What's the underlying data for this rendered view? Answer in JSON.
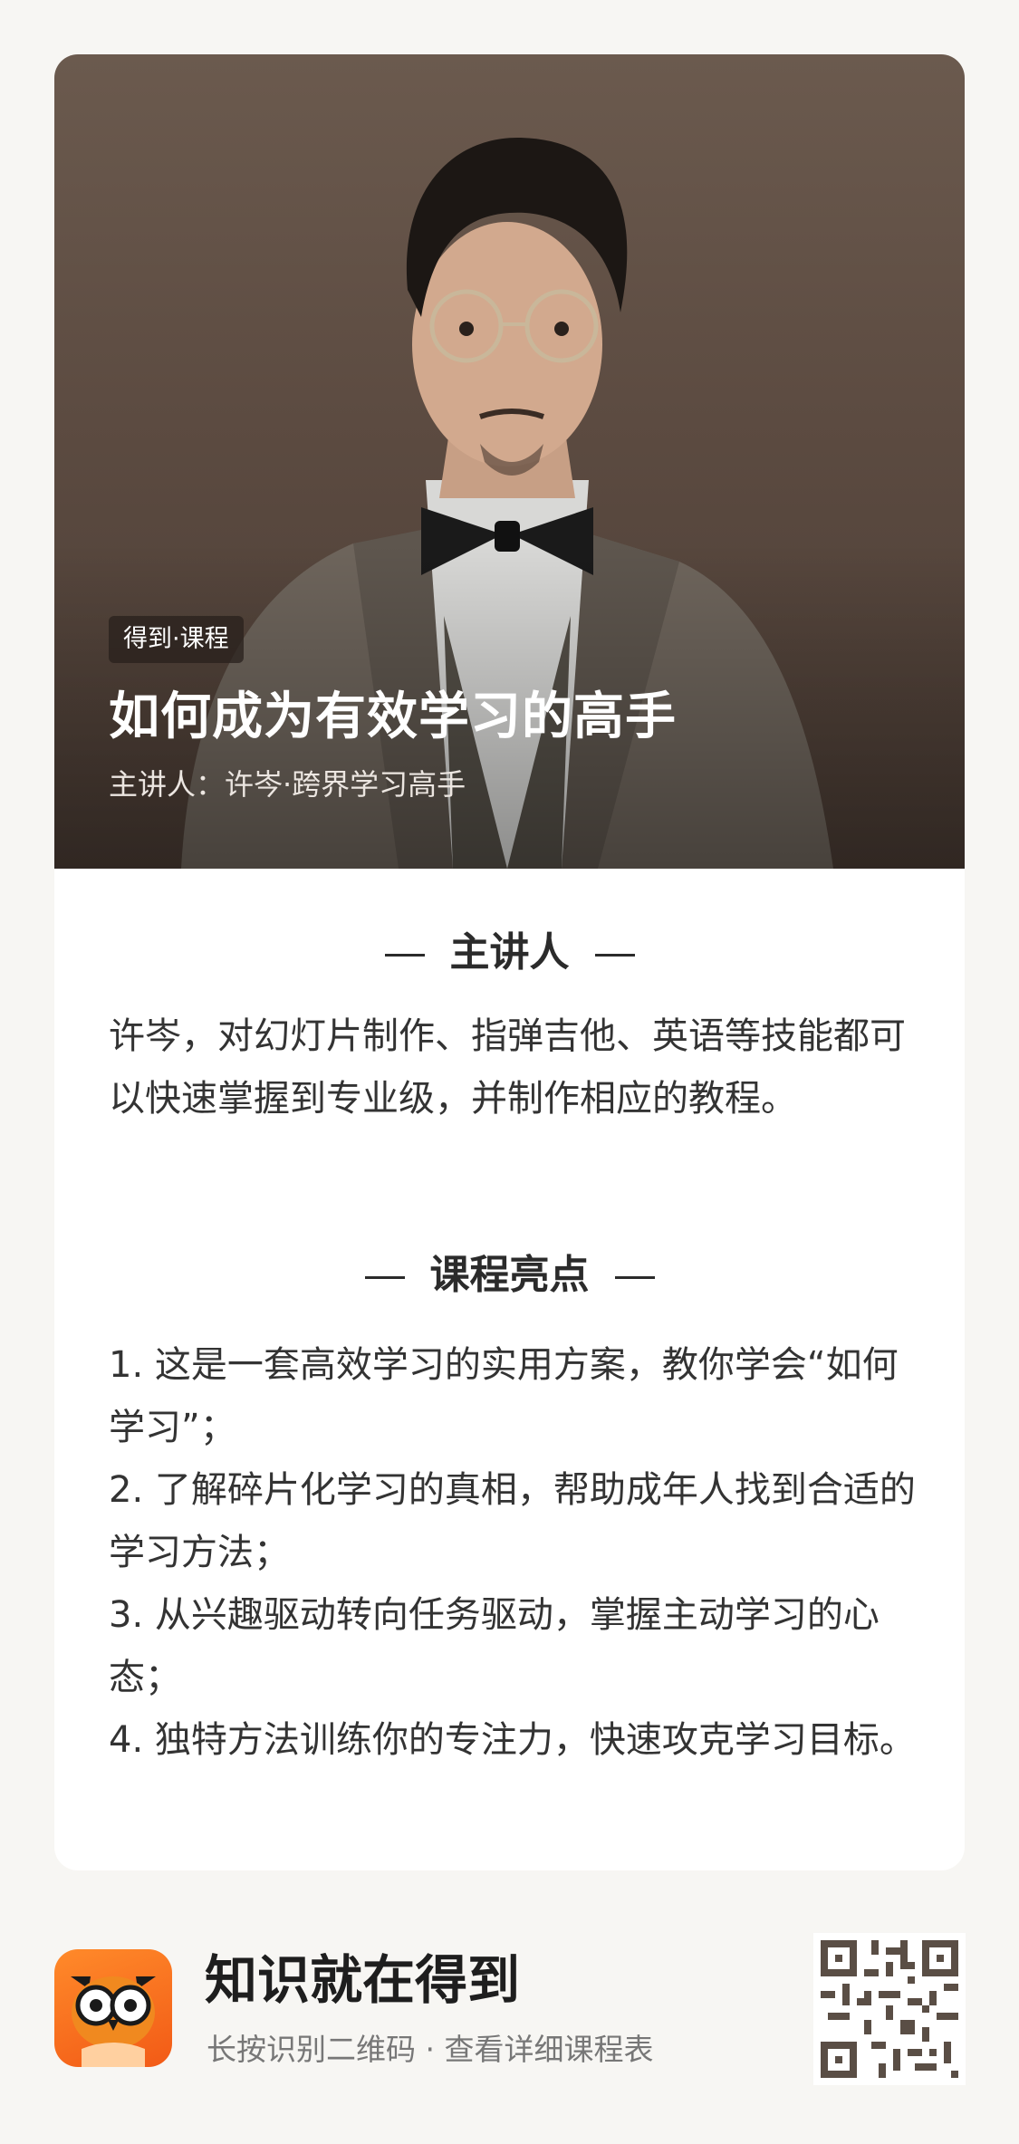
{
  "hero": {
    "badge": "得到·课程",
    "title": "如何成为有效学习的高手",
    "subtitle": "主讲人：许岑·跨界学习高手"
  },
  "presenter_section": {
    "title": "主讲人",
    "body": "许岑，对幻灯片制作、指弹吉他、英语等技能都可以快速掌握到专业级，并制作相应的教程。"
  },
  "highlights_section": {
    "title": "课程亮点",
    "items": [
      "1. 这是一套高效学习的实用方案，教你学会“如何学习”；",
      "2. 了解碎片化学习的真相，帮助成年人找到合适的学习方法；",
      "3. 从兴趣驱动转向任务驱动，掌握主动学习的心态；",
      "4. 独特方法训练你的专注力，快速攻克学习目标。"
    ]
  },
  "footer": {
    "title": "知识就在得到",
    "subtitle": "长按识别二维码 · 查看详细课程表",
    "logo_icon": "owl-icon",
    "qr_icon": "qr-code-icon"
  },
  "colors": {
    "background": "#f7f6f3",
    "accent": "#f25a16",
    "hero_brown": "#5c4b41"
  }
}
